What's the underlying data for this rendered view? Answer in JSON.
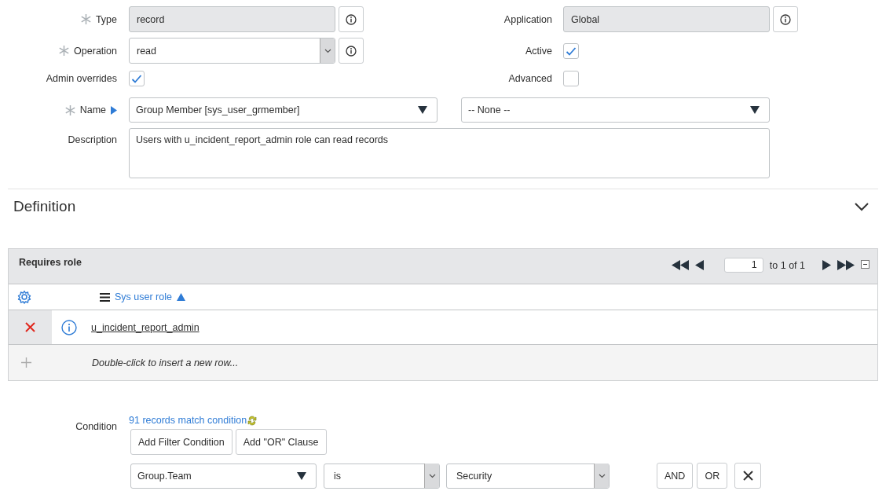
{
  "form_rows": [
    {
      "left": {
        "kind": "readonly",
        "label": "Type",
        "required": true,
        "value": "record",
        "info": true
      },
      "right": {
        "kind": "readonly",
        "label": "Application",
        "required": false,
        "value": "Global",
        "info": true
      }
    },
    {
      "left": {
        "kind": "select",
        "label": "Operation",
        "required": true,
        "value": "read",
        "info": true
      },
      "right": {
        "kind": "checkbox",
        "label": "Active",
        "checked": true
      }
    },
    {
      "left": {
        "kind": "checkbox",
        "label": "Admin overrides",
        "checked": true
      },
      "right": {
        "kind": "checkbox",
        "label": "Advanced",
        "checked": false
      }
    },
    {
      "left": {
        "kind": "table_picker",
        "label": "Name",
        "required": true,
        "value": "Group Member [sys_user_grmember]",
        "field_value": "-- None --"
      }
    },
    {
      "left": {
        "kind": "textarea",
        "label": "Description",
        "value": "Users with u_incident_report_admin role can read records"
      }
    }
  ],
  "section": {
    "title": "Definition",
    "expanded": true
  },
  "related_list": {
    "title": "Requires role",
    "page": "1",
    "range": "to 1 of 1",
    "column": "Sys user role",
    "sort_ascending": true,
    "rows": [
      {
        "value": "u_incident_report_admin"
      }
    ],
    "insert_hint": "Double-click to insert a new row..."
  },
  "condition": {
    "label": "Condition",
    "match": "91 records match condition",
    "buttons": [
      "Add Filter Condition",
      "Add \"OR\" Clause"
    ],
    "filters": [
      {
        "field": "Group.Team",
        "operator": "is",
        "value": "Security"
      }
    ],
    "row_buttons": [
      "AND",
      "OR"
    ]
  }
}
